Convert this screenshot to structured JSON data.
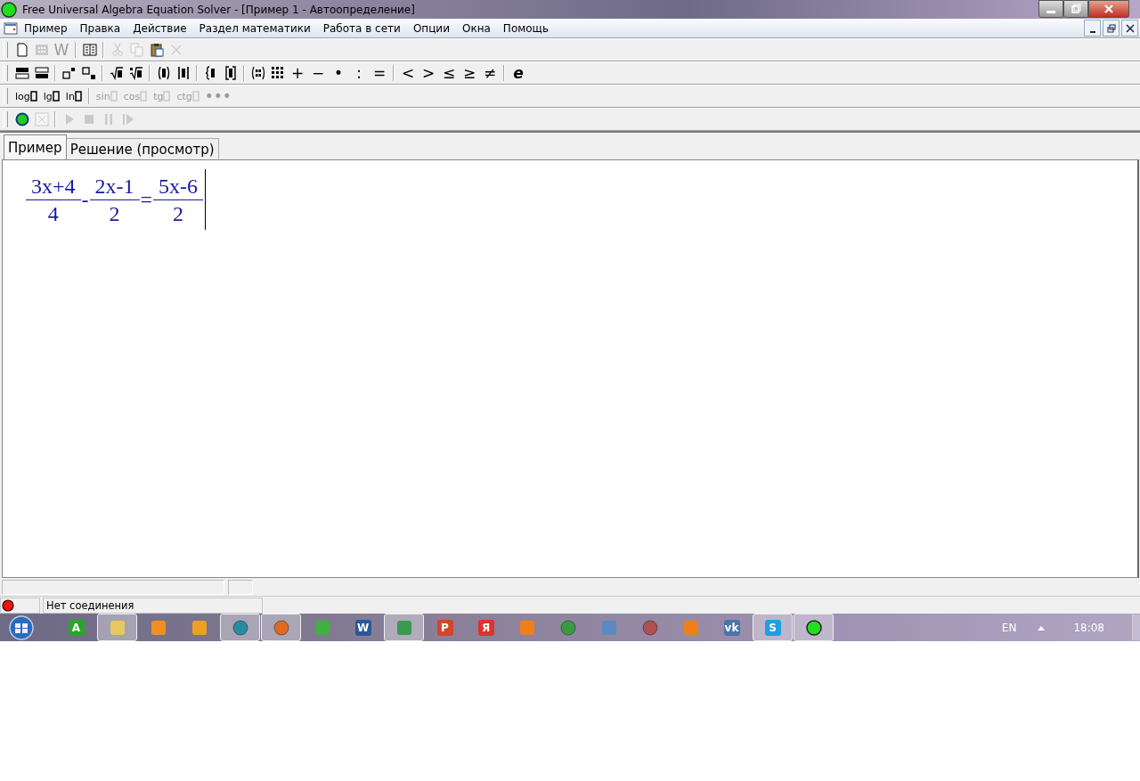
{
  "window": {
    "title": "Free Universal Algebra Equation Solver - [Пример 1 - Автоопределение]"
  },
  "menu": [
    "Пример",
    "Правка",
    "Действие",
    "Раздел математики",
    "Работа в сети",
    "Опции",
    "Окна",
    "Помощь"
  ],
  "toolbars": [
    {
      "items": [
        {
          "kind": "page",
          "disabled": false
        },
        {
          "kind": "grid",
          "disabled": true
        },
        {
          "kind": "glyph",
          "label": "W",
          "disabled": true
        },
        {
          "kind": "sep"
        },
        {
          "kind": "book",
          "disabled": false
        },
        {
          "kind": "sep"
        },
        {
          "kind": "scissors",
          "disabled": true
        },
        {
          "kind": "copy",
          "disabled": true
        },
        {
          "kind": "paste",
          "disabled": false
        },
        {
          "kind": "cross",
          "disabled": true
        }
      ]
    },
    {
      "items": [
        {
          "kind": "bars",
          "disabled": false
        },
        {
          "kind": "bars2",
          "disabled": false
        },
        {
          "kind": "sep"
        },
        {
          "kind": "sup",
          "disabled": false
        },
        {
          "kind": "sub",
          "disabled": false
        },
        {
          "kind": "sep"
        },
        {
          "kind": "root",
          "disabled": false
        },
        {
          "kind": "root2",
          "disabled": false
        },
        {
          "kind": "sep"
        },
        {
          "kind": "paren",
          "disabled": false
        },
        {
          "kind": "abs",
          "disabled": false
        },
        {
          "kind": "sep"
        },
        {
          "kind": "brace",
          "disabled": false
        },
        {
          "kind": "bracket",
          "disabled": false
        },
        {
          "kind": "sep"
        },
        {
          "kind": "matrix",
          "disabled": false
        },
        {
          "kind": "dots",
          "disabled": false
        },
        {
          "kind": "glyph",
          "label": "+",
          "disabled": false
        },
        {
          "kind": "glyph",
          "label": "−",
          "disabled": false
        },
        {
          "kind": "glyph",
          "label": "•",
          "disabled": false
        },
        {
          "kind": "glyph",
          "label": ":",
          "disabled": false
        },
        {
          "kind": "glyph",
          "label": "=",
          "disabled": false
        },
        {
          "kind": "sep"
        },
        {
          "kind": "glyph",
          "label": "<",
          "disabled": false
        },
        {
          "kind": "glyph",
          "label": ">",
          "disabled": false
        },
        {
          "kind": "glyph",
          "label": "≤",
          "disabled": false
        },
        {
          "kind": "glyph",
          "label": "≥",
          "disabled": false
        },
        {
          "kind": "glyph",
          "label": "≠",
          "disabled": false
        },
        {
          "kind": "sep"
        },
        {
          "kind": "glyph",
          "label": "e",
          "disabled": false
        }
      ]
    },
    {
      "items": [
        {
          "kind": "func",
          "label": "log",
          "disabled": false
        },
        {
          "kind": "func",
          "label": "lg",
          "disabled": false
        },
        {
          "kind": "func",
          "label": "ln",
          "disabled": false
        },
        {
          "kind": "sep"
        },
        {
          "kind": "func",
          "label": "sin",
          "disabled": true
        },
        {
          "kind": "func",
          "label": "cos",
          "disabled": true
        },
        {
          "kind": "func",
          "label": "tg",
          "disabled": true
        },
        {
          "kind": "func",
          "label": "ctg",
          "disabled": true
        },
        {
          "kind": "glyph",
          "label": "•••",
          "disabled": true
        }
      ]
    },
    {
      "items": [
        {
          "kind": "circle",
          "disabled": false
        },
        {
          "kind": "sheet",
          "disabled": true
        },
        {
          "kind": "sep"
        },
        {
          "kind": "play",
          "disabled": true
        },
        {
          "kind": "stop",
          "disabled": true
        },
        {
          "kind": "pause",
          "disabled": true
        },
        {
          "kind": "step",
          "disabled": true
        }
      ]
    }
  ],
  "tabs": [
    {
      "label": "Пример",
      "selected": true
    },
    {
      "label": "Решение (просмотр)",
      "selected": false
    }
  ],
  "equation": [
    {
      "kind": "fraction",
      "numerator": "3x+4",
      "denominator": "4"
    },
    {
      "kind": "operator",
      "text": "-"
    },
    {
      "kind": "fraction",
      "numerator": "2x-1",
      "denominator": "2"
    },
    {
      "kind": "operator",
      "text": "="
    },
    {
      "kind": "fraction",
      "numerator": "5x-6",
      "denominator": "2"
    }
  ],
  "status_bar": {
    "connection": "Нет соединения"
  },
  "taskbar": {
    "apps": [
      {
        "kind": "green",
        "glyph": "A",
        "open": false
      },
      {
        "kind": "folder",
        "open": true
      },
      {
        "kind": "player",
        "open": false
      },
      {
        "kind": "nodes",
        "open": false
      },
      {
        "kind": "mail",
        "open": true
      },
      {
        "kind": "firefox",
        "open": true
      },
      {
        "kind": "music",
        "open": false
      },
      {
        "kind": "word",
        "glyph": "W",
        "open": false
      },
      {
        "kind": "tiles",
        "open": true
      },
      {
        "kind": "ppt",
        "glyph": "P",
        "open": false
      },
      {
        "kind": "yandex",
        "glyph": "Я",
        "open": false
      },
      {
        "kind": "ok",
        "open": false
      },
      {
        "kind": "chrome",
        "open": false
      },
      {
        "kind": "speaker",
        "open": false
      },
      {
        "kind": "globe",
        "open": false
      },
      {
        "kind": "ok",
        "open": false
      },
      {
        "kind": "vk",
        "glyph": "vk",
        "open": false
      },
      {
        "kind": "skype",
        "glyph": "S",
        "open": true
      },
      {
        "kind": "solver",
        "open": true
      }
    ],
    "language": "EN",
    "time": "18:08"
  }
}
